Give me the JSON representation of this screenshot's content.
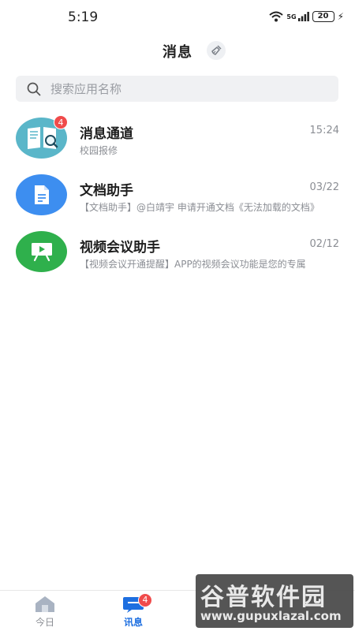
{
  "status_bar": {
    "time": "5:19",
    "network": "5G",
    "battery": "20"
  },
  "header": {
    "title": "消息"
  },
  "search": {
    "placeholder": "搜索应用名称"
  },
  "messages": [
    {
      "title": "消息通道",
      "time": "15:24",
      "preview": "校园报修",
      "badge": "4",
      "icon": "book-magnifier-icon",
      "color": "#5ab6c9"
    },
    {
      "title": "文档助手",
      "time": "03/22",
      "preview": "【文档助手】@白靖宇 申请开通文档《无法加载的文档》",
      "icon": "document-icon",
      "color": "#3d8ef0"
    },
    {
      "title": "视频会议助手",
      "time": "02/12",
      "preview": "【视频会议开通提醒】APP的视频会议功能是您的专属",
      "icon": "presentation-icon",
      "color": "#2fb04c"
    }
  ],
  "tab_bar": {
    "today_label": "今日",
    "messages_label": "讯息",
    "messages_badge": "4",
    "active_color": "#1e6fe0"
  },
  "watermark": {
    "brand": "谷普软件园",
    "url": "www.gupuxlazal.com"
  }
}
